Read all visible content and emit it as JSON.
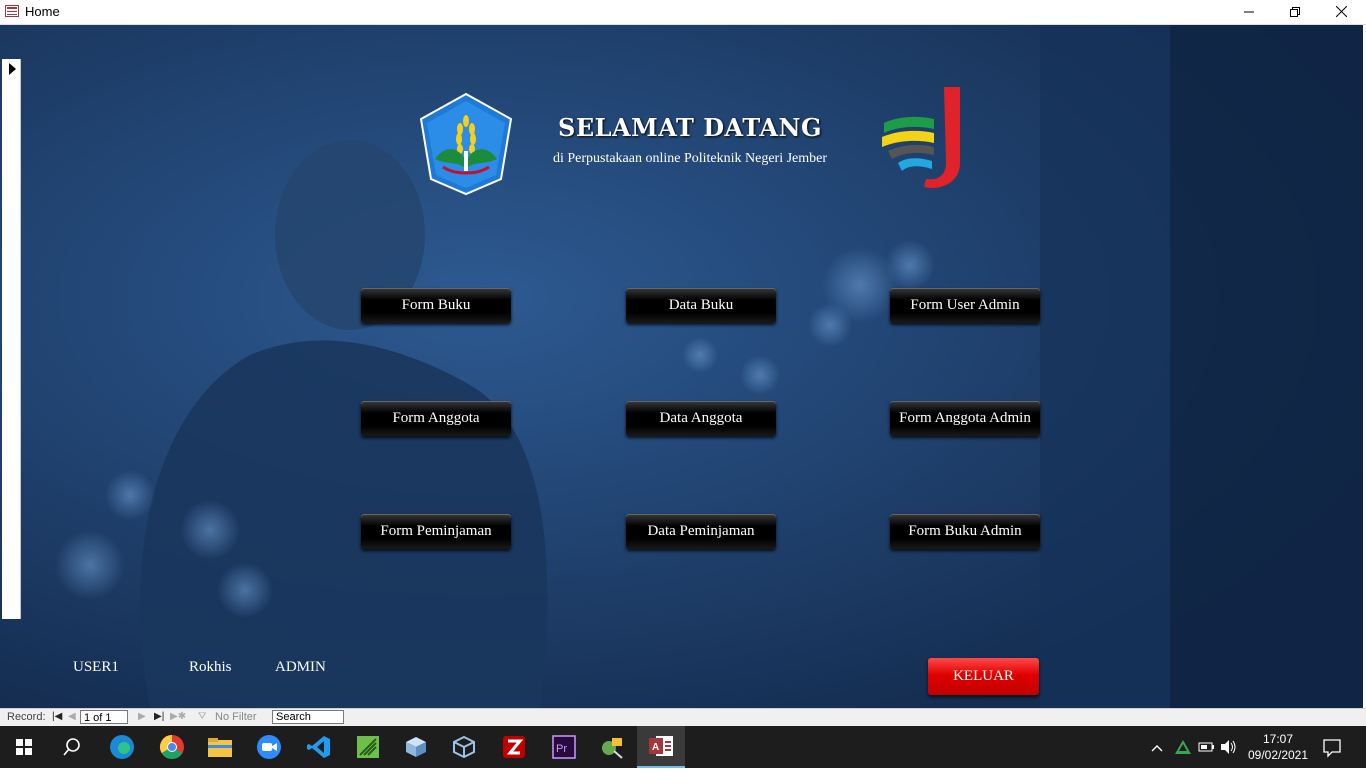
{
  "window": {
    "title": "Home",
    "minimize_icon": "minimize-icon",
    "restore_icon": "restore-icon",
    "close_icon": "close-icon"
  },
  "header": {
    "title": "SELAMAT DATANG",
    "subtitle": "di Perpustakaan online Politeknik Negeri Jember"
  },
  "buttons": {
    "form_buku": "Form Buku",
    "data_buku": "Data Buku",
    "form_user_admin": "Form User Admin",
    "form_anggota": "Form Anggota",
    "data_anggota": "Data Anggota",
    "form_anggota_admin": "Form Anggota Admin",
    "form_peminjaman": "Form Peminjaman",
    "data_peminjaman": "Data Peminjaman",
    "form_buku_admin": "Form Buku Admin",
    "keluar": "KELUAR"
  },
  "user_info": {
    "user_id": "USER1",
    "name": "Rokhis",
    "role": "ADMIN"
  },
  "record_nav": {
    "label": "Record:",
    "current": "1 of 1",
    "filter": "No Filter",
    "search_placeholder": "Search"
  },
  "taskbar": {
    "time": "17:07",
    "date": "09/02/2021",
    "apps": [
      "start-icon",
      "search-icon",
      "edge-icon",
      "chrome-icon",
      "file-explorer-icon",
      "zoom-icon",
      "vscode-icon",
      "sublime-icon",
      "app-cube-icon",
      "virtualbox-icon",
      "filezilla-icon",
      "premiere-icon",
      "tool-icon",
      "access-icon"
    ]
  },
  "colors": {
    "background": "#1e3e6b",
    "button": "#000000",
    "exit_button": "#e00000",
    "taskbar": "#1d1d1d"
  }
}
